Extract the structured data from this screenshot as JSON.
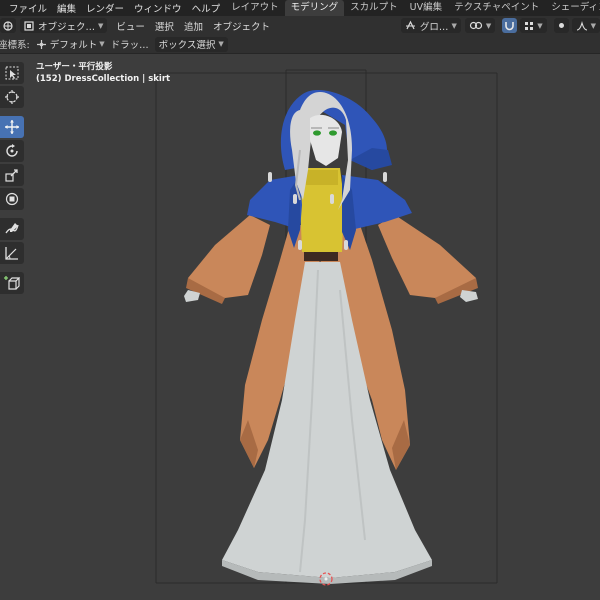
{
  "menubar": {
    "items": [
      "ファイル",
      "編集",
      "レンダー",
      "ウィンドウ",
      "ヘルプ"
    ],
    "workspaces": [
      "レイアウト",
      "モデリング",
      "スカルプト",
      "UV編集",
      "テクスチャペイント",
      "シェーディング"
    ],
    "active_workspace": "モデリング"
  },
  "viewport_header": {
    "mode": "オブジェク…",
    "menus": [
      "ビュー",
      "選択",
      "追加",
      "オブジェクト"
    ],
    "orientation": "グロ…"
  },
  "tool_header": {
    "coord_label": "座標系:",
    "coord_value": "デフォルト",
    "drag_label": "ドラッ…",
    "select_mode": "ボックス選択"
  },
  "overlay": {
    "view_name": "ユーザー・平行投影",
    "collection_info": "(152) DressCollection | skirt"
  },
  "toolbar": {
    "tools": [
      "select-box-icon",
      "cursor-icon",
      "move-icon",
      "rotate-icon",
      "scale-icon",
      "transform-icon",
      "annotate-icon",
      "measure-icon",
      "add-cube-icon"
    ],
    "active_tool": "move-icon"
  },
  "colors": {
    "accent": "#4772b3",
    "hat": "#2f55b8",
    "coat": "#c9875a",
    "skirt": "#cfd3d3",
    "shirt": "#d8c332",
    "hair": "#d4d4d4"
  }
}
